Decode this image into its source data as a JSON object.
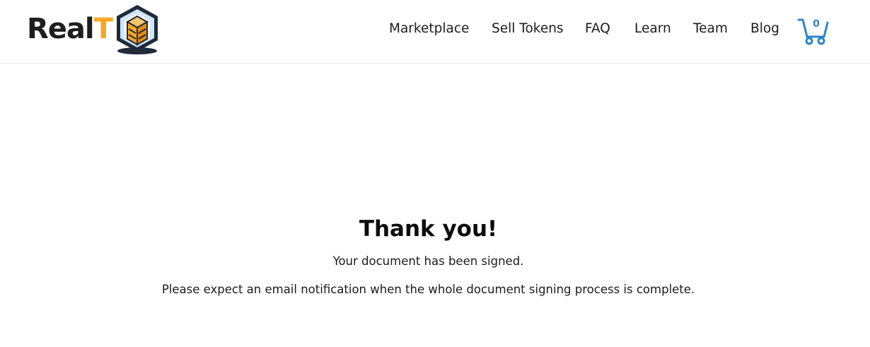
{
  "header": {
    "logo": {
      "text_main": "Real",
      "text_accent": "T",
      "accent_color": "#f7a823",
      "icon": "realt-building-hexagon-logo"
    },
    "nav": [
      {
        "label": "Marketplace"
      },
      {
        "label": "Sell Tokens"
      },
      {
        "label": "FAQ"
      },
      {
        "label": "Learn"
      },
      {
        "label": "Team"
      },
      {
        "label": "Blog"
      }
    ],
    "cart": {
      "icon": "shopping-cart-icon",
      "count": "0",
      "color": "#2d86c9"
    }
  },
  "main": {
    "title": "Thank you!",
    "message": "Your document has been signed.",
    "note": "Please expect an email notification when the whole document signing process is complete."
  }
}
